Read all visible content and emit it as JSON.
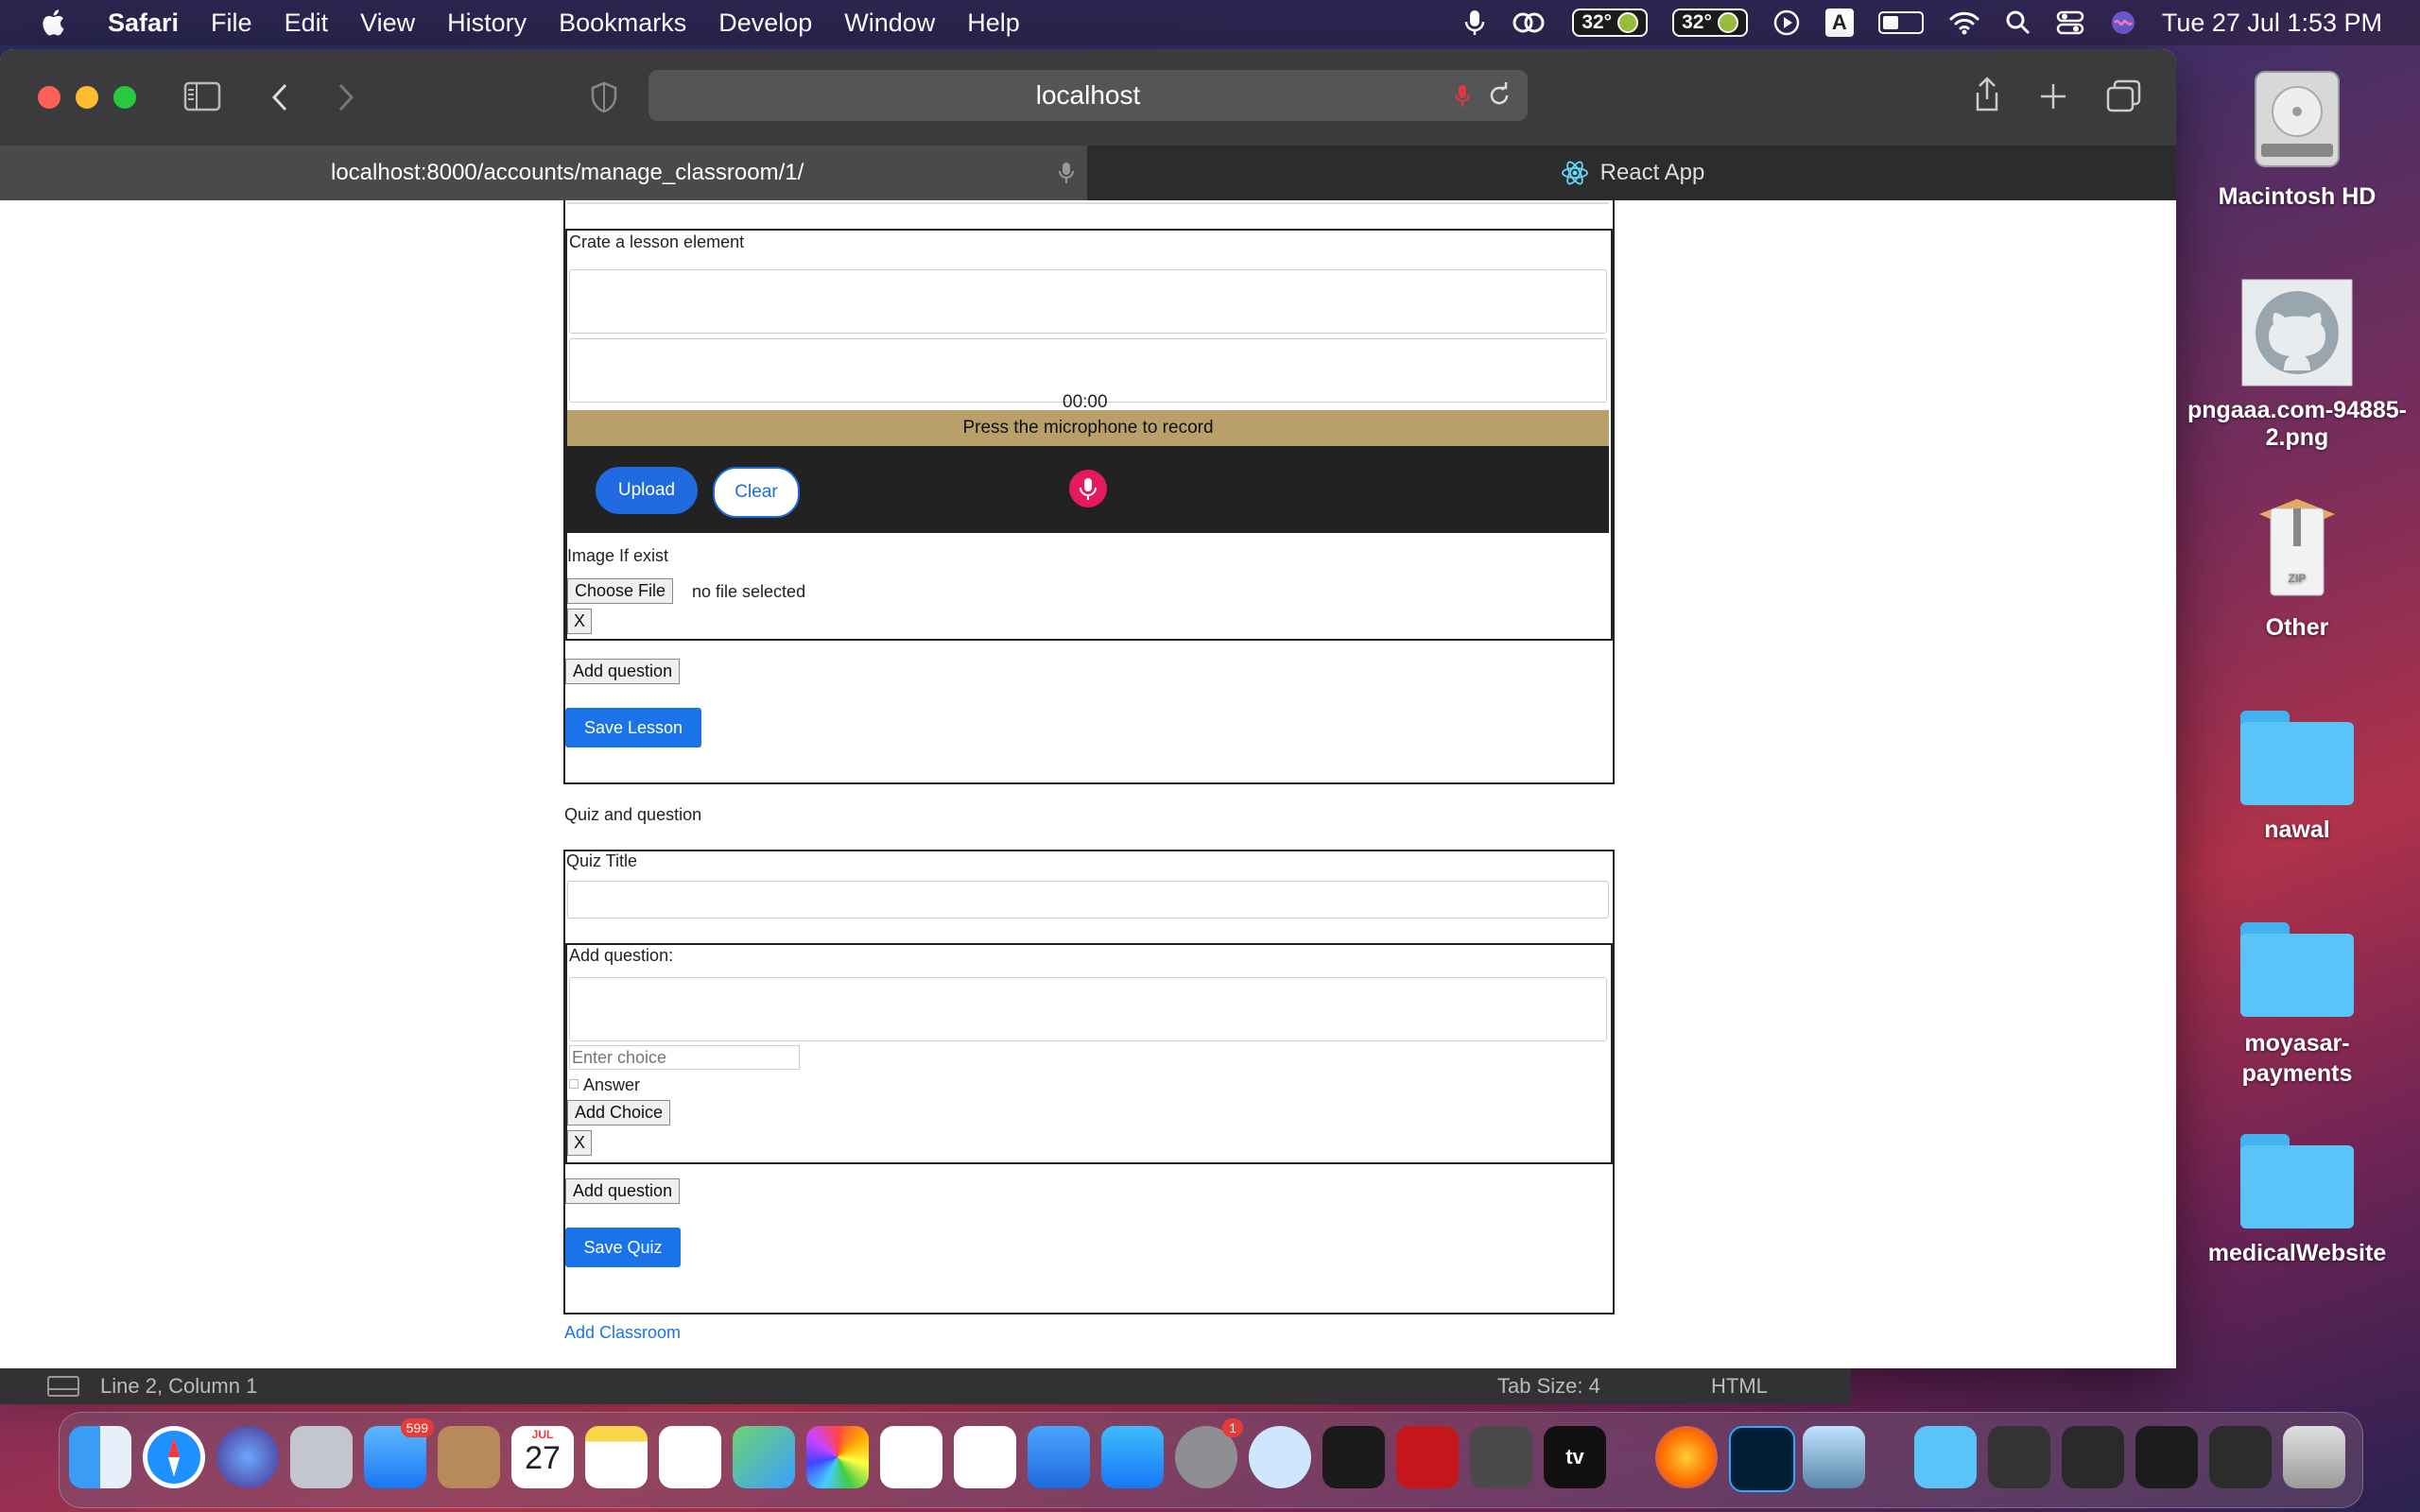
{
  "menubar": {
    "app": "Safari",
    "items": [
      "File",
      "Edit",
      "View",
      "History",
      "Bookmarks",
      "Develop",
      "Window",
      "Help"
    ],
    "temp1": "32°",
    "temp2": "32°",
    "input_source": "A",
    "datetime": "Tue 27 Jul  1:53 PM"
  },
  "browser": {
    "address": "localhost",
    "tabs": [
      {
        "title": "localhost:8000/accounts/manage_classroom/1/"
      },
      {
        "title": "React App"
      }
    ]
  },
  "lesson": {
    "element_label": "Crate a lesson element",
    "recorder_time": "00:00",
    "recorder_hint": "Press the microphone to record",
    "upload_label": "Upload",
    "clear_label": "Clear",
    "image_label": "Image If exist",
    "choose_file_label": "Choose File",
    "file_status": "no file selected",
    "remove_label": "X",
    "add_question_label": "Add question",
    "save_label": "Save Lesson"
  },
  "quiz": {
    "section_title": "Quiz and question",
    "title_label": "Quiz Title",
    "question_label": "Add question:",
    "choice_placeholder": "Enter choice",
    "answer_label": "Answer",
    "add_choice_label": "Add Choice",
    "remove_label": "X",
    "add_question_label": "Add question",
    "save_label": "Save Quiz"
  },
  "add_classroom_link": "Add Classroom",
  "editor_status": {
    "position": "Line 2, Column 1",
    "tab_size": "Tab Size: 4",
    "syntax": "HTML"
  },
  "desktop": {
    "items": [
      "Macintosh HD",
      "pngaaa.com-94885-2.png",
      "Other",
      "nawal",
      "moyasar-payments",
      "medicalWebsite"
    ]
  },
  "dock": {
    "mail_badge": "599",
    "calendar_month": "JUL",
    "calendar_day": "27",
    "settings_badge": "1",
    "tv_label": "tv"
  },
  "colors": {
    "primary_button": "#1a73e8",
    "recorder_bar": "#b9a06a",
    "mic_button": "#e5195f"
  }
}
